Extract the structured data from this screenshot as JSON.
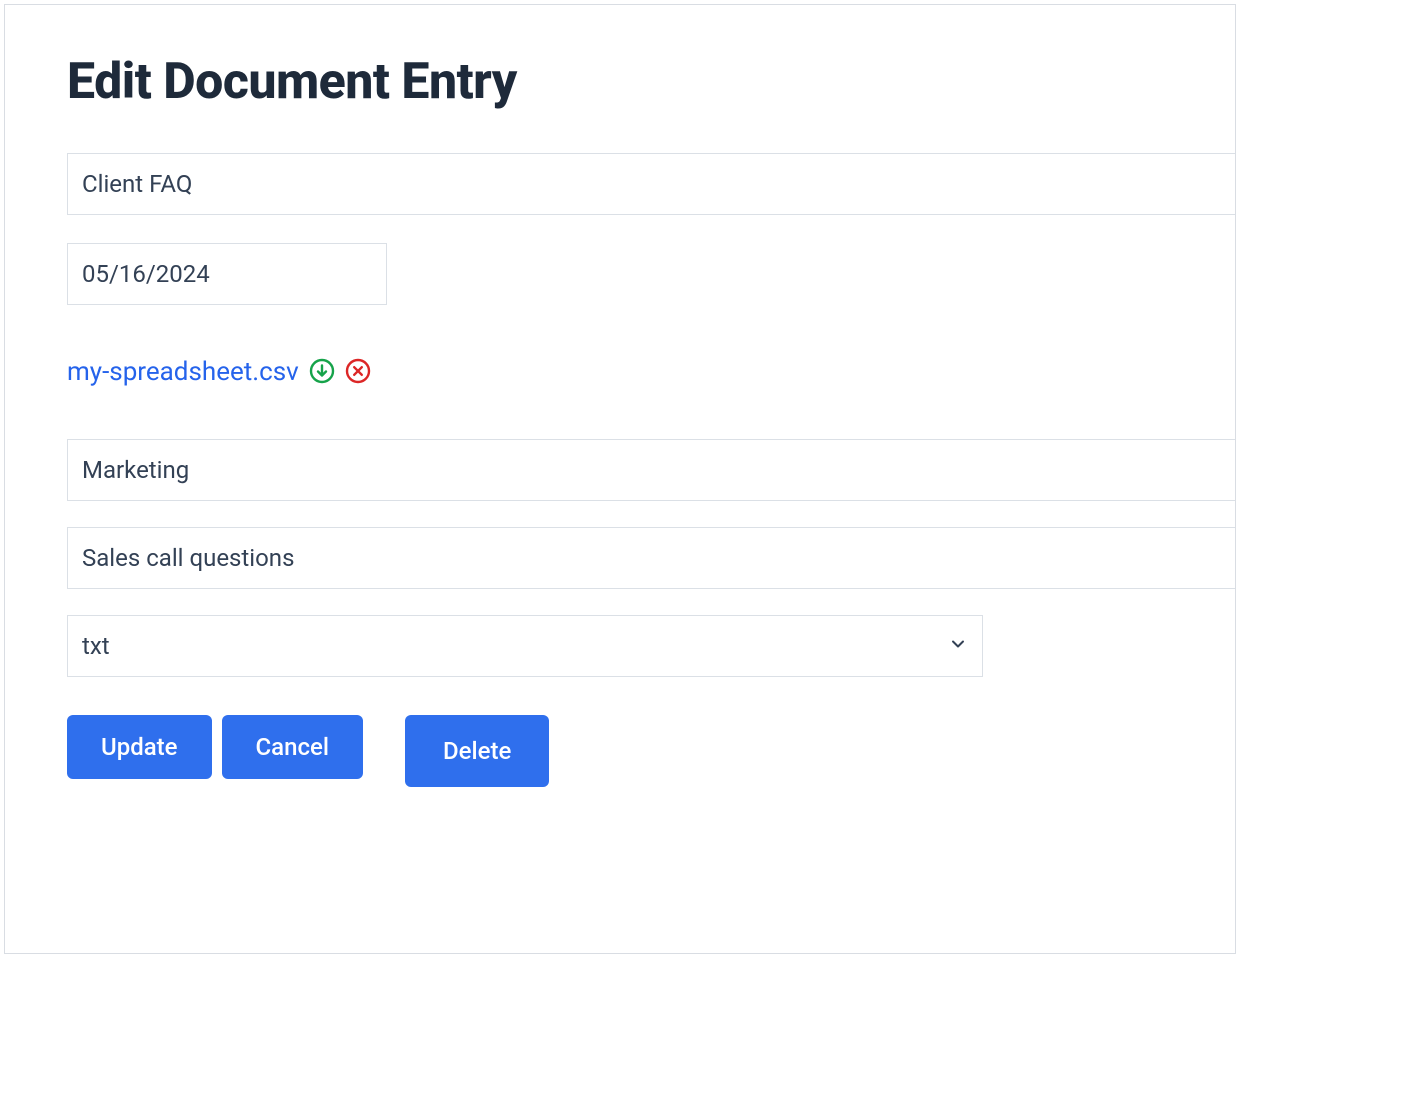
{
  "page": {
    "title": "Edit Document Entry"
  },
  "form": {
    "name_value": "Client FAQ",
    "date_value": "05/16/2024",
    "file_name": "my-spreadsheet.csv",
    "category_value": "Marketing",
    "description_value": "Sales call questions",
    "format_value": "txt"
  },
  "buttons": {
    "update": "Update",
    "cancel": "Cancel",
    "delete": "Delete"
  },
  "icons": {
    "download": "download-circle-icon",
    "remove": "remove-circle-icon",
    "chevron": "chevron-down-icon"
  }
}
